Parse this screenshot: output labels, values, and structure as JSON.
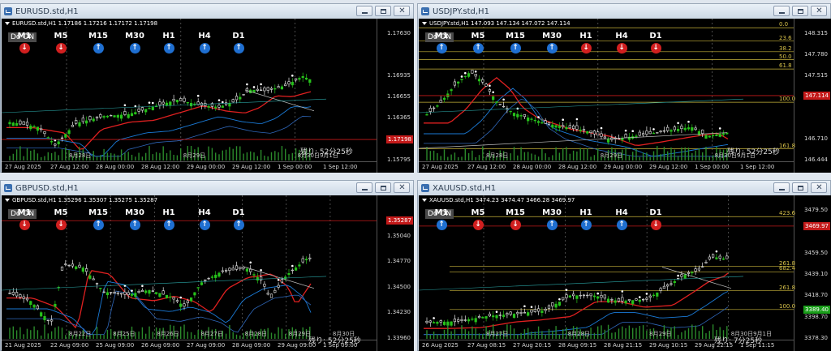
{
  "colors": {
    "up": "#1f6fd1",
    "down": "#d11f1f",
    "bull": "#27c21b",
    "bear": "#e9e9e9",
    "fib": "#c8b43a"
  },
  "windows": [
    {
      "id": "eurusd",
      "title": "EURUSD.std,H1",
      "info": "EURUSD.std,H1   1.17186 1.17216 1.17172 1.17198",
      "do_label": "Do ON",
      "tfs": [
        {
          "label": "M1",
          "dir": "down"
        },
        {
          "label": "M5",
          "dir": "down"
        },
        {
          "label": "M15",
          "dir": "up"
        },
        {
          "label": "M30",
          "dir": "up"
        },
        {
          "label": "H1",
          "dir": "up"
        },
        {
          "label": "H4",
          "dir": "up"
        },
        {
          "label": "D1",
          "dir": "up"
        }
      ],
      "prices": [
        "1.17630",
        "1.17198",
        "1.16935",
        "1.16655",
        "1.16365",
        "1.16080",
        "1.15795"
      ],
      "current": "1.17198",
      "current_level": 0.86,
      "time_labels": [
        "27 Aug 2025",
        "27 Aug 12:00",
        "28 Aug 00:00",
        "28 Aug 12:00",
        "29 Aug 00:00",
        "29 Aug 12:00",
        "1 Sep 00:00",
        "1 Sep 12:00"
      ],
      "date_marks": [
        "8月28日",
        "8月29日",
        "8月30日9月1日"
      ],
      "remaining": "残り: 52分25秒"
    },
    {
      "id": "usdjpy",
      "title": "USDJPY.std,H1",
      "info": "USDJPY.std,H1   147.093 147.134 147.072 147.114",
      "do_label": "Do ON",
      "tfs": [
        {
          "label": "M1",
          "dir": "up"
        },
        {
          "label": "M5",
          "dir": "up"
        },
        {
          "label": "M15",
          "dir": "up"
        },
        {
          "label": "M30",
          "dir": "up"
        },
        {
          "label": "H1",
          "dir": "down"
        },
        {
          "label": "H4",
          "dir": "down"
        },
        {
          "label": "D1",
          "dir": "down"
        }
      ],
      "prices": [
        "148.315",
        "147.780",
        "147.515",
        "147.245",
        "147.114",
        "146.710",
        "146.444"
      ],
      "current": "147.114",
      "current_level": 0.53,
      "fib_levels": [
        {
          "label": "0.0",
          "level": 0.02
        },
        {
          "label": "23.6",
          "level": 0.12
        },
        {
          "label": "38.2",
          "level": 0.2
        },
        {
          "label": "50.0",
          "level": 0.26
        },
        {
          "label": "61.8",
          "level": 0.33
        },
        {
          "label": "100.0",
          "level": 0.58
        },
        {
          "label": "161.8",
          "level": 0.93
        }
      ],
      "time_labels": [
        "27 Aug 2025",
        "27 Aug 12:00",
        "28 Aug 00:00",
        "28 Aug 12:00",
        "29 Aug 00:00",
        "29 Aug 12:00",
        "1 Sep 00:00",
        "1 Sep 12:00"
      ],
      "date_marks": [
        "8月28日",
        "8月29日",
        "8月30日9月1日"
      ],
      "remaining": "残り: 52分25秒"
    },
    {
      "id": "gbpusd",
      "title": "GBPUSD.std,H1",
      "info": "GBPUSD.std,H1   1.35296 1.35307 1.35275 1.35287",
      "do_label": "Do ON",
      "tfs": [
        {
          "label": "M1",
          "dir": "down"
        },
        {
          "label": "M5",
          "dir": "down"
        },
        {
          "label": "M15",
          "dir": "up"
        },
        {
          "label": "M30",
          "dir": "up"
        },
        {
          "label": "H1",
          "dir": "up"
        },
        {
          "label": "H4",
          "dir": "up"
        },
        {
          "label": "D1",
          "dir": "up"
        }
      ],
      "prices": [
        "1.35287",
        "1.35040",
        "1.34770",
        "1.34500",
        "1.34230",
        "1.33960"
      ],
      "current": "1.35287",
      "current_level": 0.14,
      "time_labels": [
        "21 Aug 2025",
        "22 Aug 09:00",
        "25 Aug 09:00",
        "26 Aug 09:00",
        "27 Aug 09:00",
        "28 Aug 09:00",
        "29 Aug 09:00",
        "1 Sep 09:00"
      ],
      "date_marks": [
        "8月22日",
        "8月25日",
        "8月26日",
        "8月27日",
        "8月28日",
        "8月29日",
        "8月30日"
      ],
      "remaining": "残り: 52分25秒"
    },
    {
      "id": "xauusd",
      "title": "XAUUSD.std,H1",
      "info": "XAUUSD.std,H1   3474.23 3474.47 3466.28 3469.97",
      "do_label": "Do ON",
      "tfs": [
        {
          "label": "M1",
          "dir": "up"
        },
        {
          "label": "M5",
          "dir": "down"
        },
        {
          "label": "M15",
          "dir": "down"
        },
        {
          "label": "M30",
          "dir": "up"
        },
        {
          "label": "H1",
          "dir": "up"
        },
        {
          "label": "H4",
          "dir": "up"
        },
        {
          "label": "D1",
          "dir": "down"
        }
      ],
      "prices": [
        "3479.50",
        "3469.97",
        "3459.50",
        "3439.10",
        "3418.70",
        "3398.70",
        "3378.30"
      ],
      "current": "3469.97",
      "green_tag": "3389.40",
      "current_level": 0.18,
      "fib_levels": [
        {
          "label": "423.6",
          "level": 0.11
        },
        {
          "label": "261.8",
          "level": 0.48
        },
        {
          "label": "682.4",
          "level": 0.52
        },
        {
          "label": "261.8",
          "level": 0.66
        },
        {
          "label": "100.0",
          "level": 0.8
        }
      ],
      "time_labels": [
        "26 Aug 2025",
        "27 Aug 08:15",
        "27 Aug 20:15",
        "28 Aug 09:15",
        "28 Aug 21:15",
        "29 Aug 10:15",
        "29 Aug 22:15",
        "1 Sep 11:15"
      ],
      "date_marks": [
        "8月27日",
        "8月28日",
        "8月29日",
        "8月30日9月1日"
      ],
      "remaining": "残り: 7分25秒"
    }
  ]
}
